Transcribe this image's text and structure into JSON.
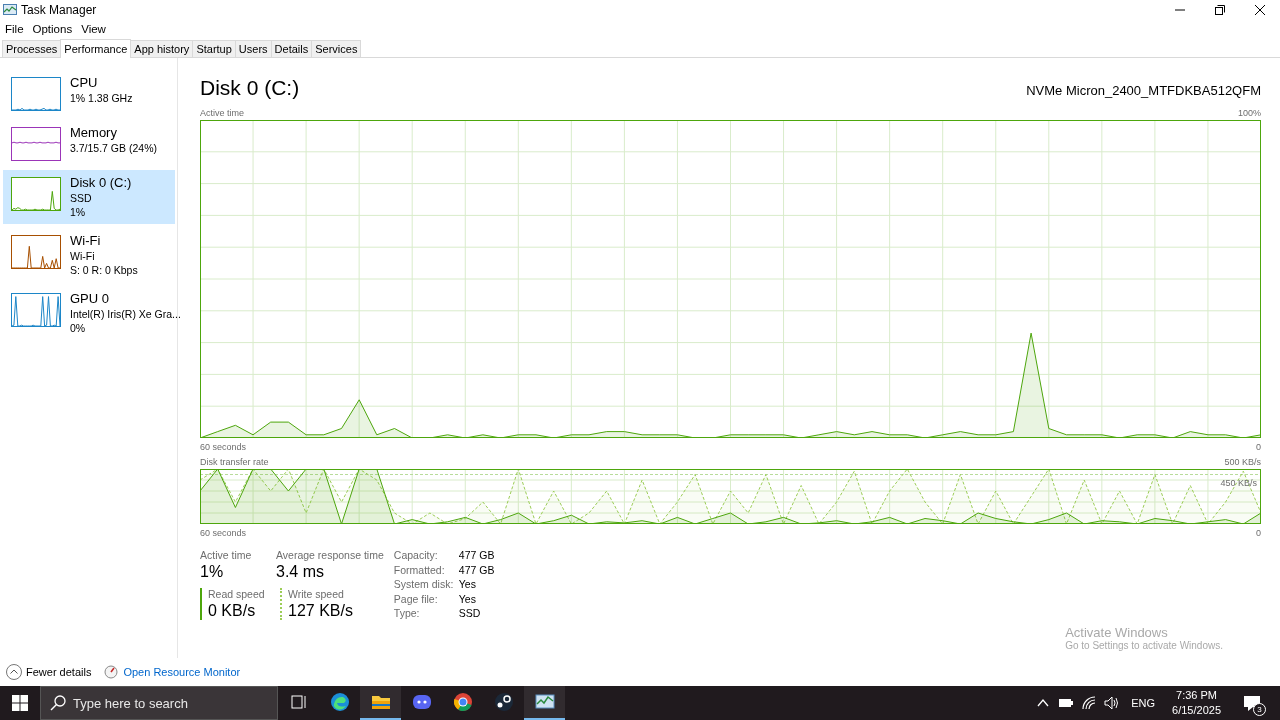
{
  "window": {
    "title": "Task Manager"
  },
  "menu": [
    "File",
    "Options",
    "View"
  ],
  "tabs": [
    {
      "label": "Processes",
      "selected": false
    },
    {
      "label": "Performance",
      "selected": true
    },
    {
      "label": "App history",
      "selected": false
    },
    {
      "label": "Startup",
      "selected": false
    },
    {
      "label": "Users",
      "selected": false
    },
    {
      "label": "Details",
      "selected": false
    },
    {
      "label": "Services",
      "selected": false
    }
  ],
  "sidebar": {
    "items": [
      {
        "title": "CPU",
        "lines": [
          "1%  1.38 GHz"
        ],
        "color": "#1c86c8",
        "selected": false
      },
      {
        "title": "Memory",
        "lines": [
          "3.7/15.7 GB (24%)"
        ],
        "color": "#9b35b8",
        "selected": false
      },
      {
        "title": "Disk 0 (C:)",
        "lines": [
          "SSD",
          "1%"
        ],
        "color": "#4da60c",
        "selected": true
      },
      {
        "title": "Wi-Fi",
        "lines": [
          "Wi-Fi",
          "S: 0 R: 0 Kbps"
        ],
        "color": "#a74f01",
        "selected": false
      },
      {
        "title": "GPU 0",
        "lines": [
          "Intel(R) Iris(R) Xe Gra...",
          "0%"
        ],
        "color": "#1c86c8",
        "selected": false
      }
    ]
  },
  "detail": {
    "title": "Disk 0 (C:)",
    "device": "NVMe Micron_2400_MTFDKBA512QFM",
    "graphs": [
      {
        "kind": "active",
        "title": "Active time",
        "max_label": "100%",
        "span_label": "60 seconds",
        "min_label": "0"
      },
      {
        "kind": "transfer",
        "title": "Disk transfer rate",
        "max_label": "500 KB/s",
        "span_label": "60 seconds",
        "min_label": "0",
        "reference_label": "450 KB/s"
      }
    ],
    "stats": [
      {
        "label": "Active time",
        "value": "1%"
      },
      {
        "label": "Average response time",
        "value": "3.4 ms"
      }
    ],
    "speeds": [
      {
        "kind": "solid",
        "label": "Read speed",
        "value": "0 KB/s"
      },
      {
        "kind": "dashed",
        "label": "Write speed",
        "value": "127 KB/s"
      }
    ],
    "properties": [
      {
        "label": "Capacity:",
        "value": "477 GB"
      },
      {
        "label": "Formatted:",
        "value": "477 GB"
      },
      {
        "label": "System disk:",
        "value": "Yes"
      },
      {
        "label": "Page file:",
        "value": "Yes"
      },
      {
        "label": "Type:",
        "value": "SSD"
      }
    ]
  },
  "footer": {
    "fewer_details": "Fewer details",
    "link": "Open Resource Monitor"
  },
  "activation": {
    "title": "Activate Windows",
    "text": "Go to Settings to activate Windows."
  },
  "taskbar": {
    "search_placeholder": "Type here to search",
    "language": "ENG",
    "time": "7:36 PM",
    "date": "6/15/2025",
    "notifications": "3"
  }
}
